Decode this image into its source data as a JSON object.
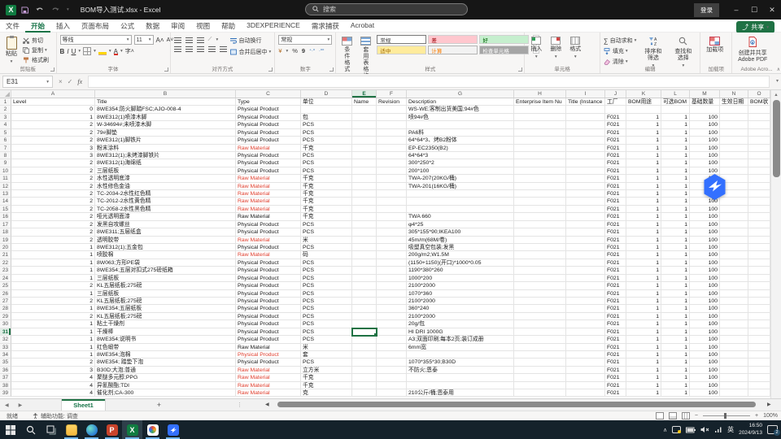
{
  "window": {
    "title": "BOM导入测试.xlsx - Excel",
    "search_placeholder": "搜索",
    "sign_in": "登录",
    "minimize": "–",
    "maximize": "☐",
    "close": "✕"
  },
  "menu": {
    "tabs": [
      "文件",
      "开始",
      "插入",
      "页面布局",
      "公式",
      "数据",
      "审阅",
      "视图",
      "帮助",
      "3DEXPERIENCE",
      "需求捕获",
      "Acrobat"
    ],
    "active_index": 1,
    "share_label": "共享"
  },
  "ribbon": {
    "clipboard": {
      "paste": "粘贴",
      "cut": "剪切",
      "copy": "复制",
      "painter": "格式刷",
      "label": "剪贴板"
    },
    "font": {
      "name": "等线",
      "size": "11",
      "label": "字体"
    },
    "alignment": {
      "wrap": "自动换行",
      "merge": "合并后居中",
      "label": "对齐方式"
    },
    "number": {
      "format": "常规",
      "label": "数字"
    },
    "styles": {
      "cond": "条件格式",
      "table": "套用表格格式",
      "gallery": [
        "常规",
        "差",
        "好",
        "适中",
        "计算",
        "检查单元格"
      ],
      "label": "样式"
    },
    "cells": {
      "insert": "插入",
      "delete": "删除",
      "format": "格式",
      "label": "单元格"
    },
    "editing": {
      "autosum": "自动求和",
      "fill": "填充",
      "clear": "清除",
      "sort": "排序和筛选",
      "find": "查找和选择",
      "label": "编辑"
    },
    "addins": {
      "addin": "加载项",
      "label": "加载项"
    },
    "adobe": {
      "create1": "创建并共享",
      "create2": "Adobe PDF",
      "label": "Adobe Acro..."
    }
  },
  "formula_bar": {
    "cell_ref": "E31",
    "formula": ""
  },
  "grid": {
    "col_letters": [
      "A",
      "B",
      "C",
      "D",
      "E",
      "F",
      "G",
      "H",
      "I",
      "J",
      "K",
      "L",
      "M",
      "N",
      "O"
    ],
    "selected_col": "E",
    "selected_row": 31,
    "field_headers": [
      "Level",
      "Title",
      "Type",
      "单位",
      "Name",
      "Revision",
      "Description",
      "Enterprise Item Nu",
      "Title (Instance",
      "工厂",
      "BOM用途",
      "可选BOM",
      "基础数量",
      "生效日期",
      "BOM状"
    ],
    "rows": [
      {
        "n": 2,
        "lv": "0",
        "t": "8WE354;防火脚踏FSC;AJO-008-4",
        "ty": "Physical Product",
        "red": false,
        "u": "",
        "d": "WS-WE;客制出货美国;94#色",
        "f": "",
        "b": "",
        "o": "",
        "q": ""
      },
      {
        "n": 3,
        "lv": "1",
        "t": "8WE312(1)喷漆木脚",
        "ty": "Physical Product",
        "red": false,
        "u": "包",
        "d": "喷94#色",
        "f": "F021",
        "b": "1",
        "o": "1",
        "q": "100"
      },
      {
        "n": 4,
        "lv": "2",
        "t": "W-34694#;未喷漆木脚",
        "ty": "Physical Product",
        "red": false,
        "u": "PCS",
        "d": "",
        "f": "F021",
        "b": "1",
        "o": "1",
        "q": "100"
      },
      {
        "n": 5,
        "lv": "2",
        "t": "79#脚垫",
        "ty": "Physical Product",
        "red": false,
        "u": "PCS",
        "d": "PA6料",
        "f": "F021",
        "b": "1",
        "o": "1",
        "q": "100"
      },
      {
        "n": 6,
        "lv": "2",
        "t": "8WE312(1)脚铁片",
        "ty": "Physical Product",
        "red": false,
        "u": "PCS",
        "d": "64*64*3、烤B2粉体",
        "f": "F021",
        "b": "1",
        "o": "1",
        "q": "100"
      },
      {
        "n": 7,
        "lv": "3",
        "t": "粉末涂料",
        "ty": "Raw Material",
        "red": true,
        "u": "千克",
        "d": "EP-EC2350(B2)",
        "f": "F021",
        "b": "1",
        "o": "1",
        "q": "100"
      },
      {
        "n": 8,
        "lv": "3",
        "t": "8WE312(1);未烤漆脚铁片",
        "ty": "Physical Product",
        "red": false,
        "u": "PCS",
        "d": "64*64*3",
        "f": "F021",
        "b": "1",
        "o": "1",
        "q": "100"
      },
      {
        "n": 9,
        "lv": "2",
        "t": "8WE312(1)海绵纸",
        "ty": "Physical Product",
        "red": false,
        "u": "PCS",
        "d": "300*250*2",
        "f": "F021",
        "b": "1",
        "o": "1",
        "q": "100"
      },
      {
        "n": 10,
        "lv": "2",
        "t": "三层纸板",
        "ty": "Physical Product",
        "red": false,
        "u": "PCS",
        "d": "200*100",
        "f": "F021",
        "b": "1",
        "o": "1",
        "q": "100"
      },
      {
        "n": 11,
        "lv": "2",
        "t": "水性透明底漆",
        "ty": "Raw Material",
        "red": true,
        "u": "千克",
        "d": "TWA-207(20KG/桶)",
        "f": "F021",
        "b": "1",
        "o": "1",
        "q": "100"
      },
      {
        "n": 12,
        "lv": "2",
        "t": "水性修色金油",
        "ty": "Raw Material",
        "red": true,
        "u": "千克",
        "d": "TWA-201(16KG/桶)",
        "f": "F021",
        "b": "1",
        "o": "1",
        "q": "100"
      },
      {
        "n": 13,
        "lv": "2",
        "t": "TC-2034-2水性红色精",
        "ty": "Raw Material",
        "red": true,
        "u": "千克",
        "d": "",
        "f": "F021",
        "b": "1",
        "o": "1",
        "q": "100"
      },
      {
        "n": 14,
        "lv": "2",
        "t": "TC-2012-2水性黄色精",
        "ty": "Raw Material",
        "red": true,
        "u": "千克",
        "d": "",
        "f": "F021",
        "b": "1",
        "o": "1",
        "q": "100"
      },
      {
        "n": 15,
        "lv": "2",
        "t": "TC-2058-2水性黑色精",
        "ty": "Raw Material",
        "red": true,
        "u": "千克",
        "d": "",
        "f": "F021",
        "b": "1",
        "o": "1",
        "q": "100"
      },
      {
        "n": 16,
        "lv": "2",
        "t": "哑光透明面漆",
        "ty": "Raw Material",
        "red": false,
        "u": "千克",
        "d": "TWA 660",
        "f": "F021",
        "b": "1",
        "o": "1",
        "q": "100"
      },
      {
        "n": 17,
        "lv": "2",
        "t": "发黑自攻螺丝",
        "ty": "Physical Product",
        "red": false,
        "u": "PCS",
        "d": "φ4*25",
        "f": "F021",
        "b": "1",
        "o": "1",
        "q": "100"
      },
      {
        "n": 18,
        "lv": "2",
        "t": "8WE311;五层纸盒",
        "ty": "Physical Product",
        "red": false,
        "u": "PCS",
        "d": "305*155*90;IKEA100",
        "f": "F021",
        "b": "1",
        "o": "1",
        "q": "100"
      },
      {
        "n": 19,
        "lv": "2",
        "t": "透明胶带",
        "ty": "Raw Material",
        "red": true,
        "u": "米",
        "d": "45m/m(68M/卷)",
        "f": "F021",
        "b": "1",
        "o": "1",
        "q": "100"
      },
      {
        "n": 20,
        "lv": "1",
        "t": "8WE312(1);五金包",
        "ty": "Physical Product",
        "red": false,
        "u": "PCS",
        "d": "吸塑真空包装;发黑",
        "f": "F021",
        "b": "1",
        "o": "1",
        "q": "100"
      },
      {
        "n": 21,
        "lv": "1",
        "t": "喷胶棉",
        "ty": "Raw Material",
        "red": true,
        "u": "码",
        "d": "200g/m2;W1.5M",
        "f": "F021",
        "b": "1",
        "o": "1",
        "q": "100"
      },
      {
        "n": 22,
        "lv": "1",
        "t": "8W063;方形PE袋",
        "ty": "Physical Product",
        "red": false,
        "u": "PCS",
        "d": "(1150+1150)(开口)*1000*0.05",
        "f": "F021",
        "b": "1",
        "o": "1",
        "q": "100"
      },
      {
        "n": 23,
        "lv": "1",
        "t": "8WE354;五层对扣式275磅纸箱",
        "ty": "Physical Product",
        "red": false,
        "u": "PCS",
        "d": "1190*380*260",
        "f": "F021",
        "b": "1",
        "o": "1",
        "q": "100"
      },
      {
        "n": 24,
        "lv": "1",
        "t": "三层纸板",
        "ty": "Physical Product",
        "red": false,
        "u": "PCS",
        "d": "1000*200",
        "f": "F021",
        "b": "1",
        "o": "1",
        "q": "100"
      },
      {
        "n": 25,
        "lv": "2",
        "t": "KL五层纸板;275磅",
        "ty": "Physical Product",
        "red": false,
        "u": "PCS",
        "d": "2100*2000",
        "f": "F021",
        "b": "1",
        "o": "1",
        "q": "100"
      },
      {
        "n": 26,
        "lv": "1",
        "t": "三层纸板",
        "ty": "Physical Product",
        "red": false,
        "u": "PCS",
        "d": "1070*360",
        "f": "F021",
        "b": "1",
        "o": "1",
        "q": "100"
      },
      {
        "n": 27,
        "lv": "2",
        "t": "KL五层纸板;275磅",
        "ty": "Physical Product",
        "red": false,
        "u": "PCS",
        "d": "2100*2000",
        "f": "F021",
        "b": "1",
        "o": "1",
        "q": "100"
      },
      {
        "n": 28,
        "lv": "1",
        "t": "8WE354;五层纸板",
        "ty": "Physical Product",
        "red": false,
        "u": "PCS",
        "d": "360*240",
        "f": "F021",
        "b": "1",
        "o": "1",
        "q": "100"
      },
      {
        "n": 29,
        "lv": "2",
        "t": "KL五层纸板;275磅",
        "ty": "Physical Product",
        "red": false,
        "u": "PCS",
        "d": "2100*2000",
        "f": "F021",
        "b": "1",
        "o": "1",
        "q": "100"
      },
      {
        "n": 30,
        "lv": "1",
        "t": "粘土干燥剂",
        "ty": "Physical Product",
        "red": false,
        "u": "PCS",
        "d": "20g/包",
        "f": "F021",
        "b": "1",
        "o": "1",
        "q": "100"
      },
      {
        "n": 31,
        "lv": "1",
        "t": "干燥棒",
        "ty": "Physical Product",
        "red": false,
        "u": "PCS",
        "d": "HI DRI 1000G",
        "f": "F021",
        "b": "1",
        "o": "1",
        "q": "100"
      },
      {
        "n": 32,
        "lv": "1",
        "t": "8WE354;说明书",
        "ty": "Physical Product",
        "red": false,
        "u": "PCS",
        "d": "A3;双面印刷;每本2页;装订成册",
        "f": "F021",
        "b": "1",
        "o": "1",
        "q": "100"
      },
      {
        "n": 33,
        "lv": "1",
        "t": "红色缎带",
        "ty": "Raw Material",
        "red": false,
        "u": "米",
        "d": "6mm宽",
        "f": "F021",
        "b": "1",
        "o": "1",
        "q": "100"
      },
      {
        "n": 34,
        "lv": "1",
        "t": "8WE354;泡棉",
        "ty": "Physical Product",
        "red": true,
        "u": "套",
        "d": "",
        "f": "F021",
        "b": "1",
        "o": "1",
        "q": "100"
      },
      {
        "n": 35,
        "lv": "2",
        "t": "8WE354; 踏垫下泡",
        "ty": "Physical Product",
        "red": false,
        "u": "PCS",
        "d": "1070*355*30;B30D",
        "f": "F021",
        "b": "1",
        "o": "1",
        "q": "100"
      },
      {
        "n": 36,
        "lv": "3",
        "t": "B30D;大泡;普通",
        "ty": "Raw Material",
        "red": true,
        "u": "立方米",
        "d": "不防火;恩泰",
        "f": "F021",
        "b": "1",
        "o": "1",
        "q": "100"
      },
      {
        "n": 37,
        "lv": "4",
        "t": "聚醚多元醇;PPG",
        "ty": "Raw Material",
        "red": true,
        "u": "千克",
        "d": "",
        "f": "F021",
        "b": "1",
        "o": "1",
        "q": "100"
      },
      {
        "n": 38,
        "lv": "4",
        "t": "异氰酸酯;TDI",
        "ty": "Raw Material",
        "red": true,
        "u": "千克",
        "d": "",
        "f": "F021",
        "b": "1",
        "o": "1",
        "q": "100"
      },
      {
        "n": 39,
        "lv": "4",
        "t": "催化剂;CA-300",
        "ty": "Raw Material",
        "red": true,
        "u": "克",
        "d": "210公斤/桶;恩泰用",
        "f": "F021",
        "b": "1",
        "o": "1",
        "q": "100"
      }
    ]
  },
  "tabs_bar": {
    "sheet": "Sheet1",
    "add": "+"
  },
  "status_bar": {
    "mode": "就绪",
    "accessibility": "辅助功能: 调查",
    "zoom": "100%"
  },
  "taskbar": {
    "apps": [
      "start",
      "search",
      "task-view",
      "file-explorer",
      "edge",
      "powerpoint",
      "excel",
      "meeting-app",
      "feishu"
    ],
    "ime": "英",
    "time": "16:50",
    "date": "2024/9/13",
    "badge": "2"
  },
  "colors": {
    "excel_green": "#107c41",
    "raw_material_red": "#e03e2d",
    "feishu_blue": "#3370ff",
    "selection_green": "#1f7244"
  }
}
